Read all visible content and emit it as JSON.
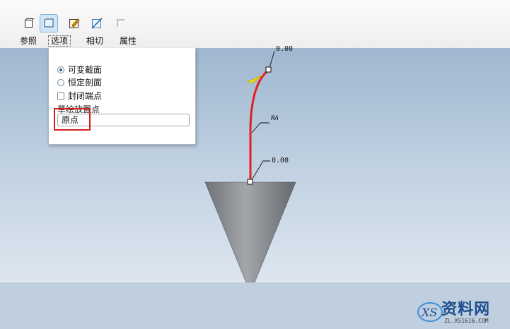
{
  "toolbar": {
    "buttons": [
      {
        "icon": "section-box-icon"
      },
      {
        "icon": "surface-sweep-icon",
        "active": true
      },
      {
        "icon": "sketch-edit-icon"
      },
      {
        "icon": "tangent-plane-icon"
      },
      {
        "icon": "open-corner-icon"
      }
    ],
    "tabs": {
      "references": "参照",
      "options": "选项",
      "tangency": "相切",
      "properties": "属性"
    }
  },
  "options_panel": {
    "variable_section": "可变截面",
    "constant_section": "恒定剖面",
    "selected_section": "variable",
    "merge_ends": "封闭端点",
    "merge_ends_checked": false,
    "sketch_placement_label": "草绘放置点",
    "sketch_placement_value": "原点"
  },
  "viewport": {
    "dim_top": "0.00",
    "dim_middle": "RA",
    "dim_bottom": "0.00",
    "curve_color": "#e02020",
    "cone_color": "#8c9094"
  },
  "watermark": {
    "text": "资料网",
    "url": "ZL.XS1616.COM"
  }
}
